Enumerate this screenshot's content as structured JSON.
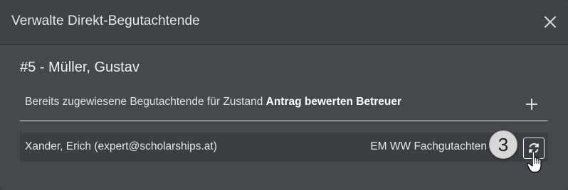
{
  "modal": {
    "title": "Verwalte Direkt-Begutachtende",
    "close_icon": "close-icon"
  },
  "person": {
    "title": "#5 - Müller, Gustav"
  },
  "section": {
    "prefix": "Bereits zugewiesene Begutachtende für Zustand ",
    "state": "Antrag bewerten Betreuer",
    "add_icon": "plus-icon"
  },
  "assignments": [
    {
      "name": "Xander, Erich (expert@scholarships.at)",
      "type": "EM WW Fachgutachten",
      "action_icon": "refresh-icon"
    }
  ],
  "annotation": {
    "step_number": "3",
    "cursor_icon": "hand-pointer-icon"
  }
}
